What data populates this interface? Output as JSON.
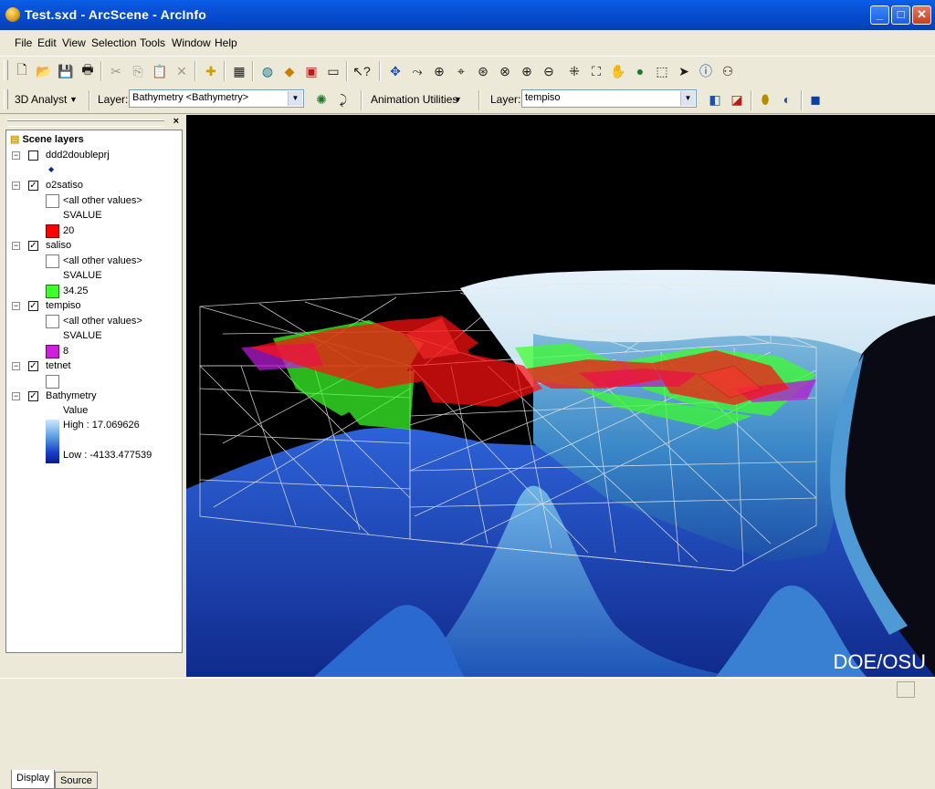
{
  "window": {
    "title": "Test.sxd - ArcScene - ArcInfo"
  },
  "menu": [
    "File",
    "Edit",
    "View",
    "Selection",
    "Tools",
    "Window",
    "Help"
  ],
  "toolbar2": {
    "analyst_label": "3D Analyst",
    "layer_label_1": "Layer:",
    "layer_value_1": "Bathymetry <Bathymetry>",
    "animation_label": "Animation Utilities",
    "layer_label_2": "Layer:",
    "layer_value_2": "tempiso"
  },
  "toc": {
    "root": "Scene layers",
    "layers": {
      "ddd": {
        "name": "ddd2doubleprj"
      },
      "o2satiso": {
        "name": "o2satiso",
        "other": "<all other values>",
        "field": "SVALUE",
        "value": "20",
        "color": "#ff0000"
      },
      "saliso": {
        "name": "saliso",
        "other": "<all other values>",
        "field": "SVALUE",
        "value": "34.25",
        "color": "#3cff2a"
      },
      "tempiso": {
        "name": "tempiso",
        "other": "<all other values>",
        "field": "SVALUE",
        "value": "8",
        "color": "#d01ee0"
      },
      "tetnet": {
        "name": "tetnet"
      },
      "bathymetry": {
        "name": "Bathymetry",
        "field": "Value",
        "high": "High : 17.069626",
        "low": "Low : -4133.477539"
      }
    }
  },
  "tabs": {
    "display": "Display",
    "source": "Source"
  },
  "view": {
    "credit": "DOE/OSU"
  }
}
